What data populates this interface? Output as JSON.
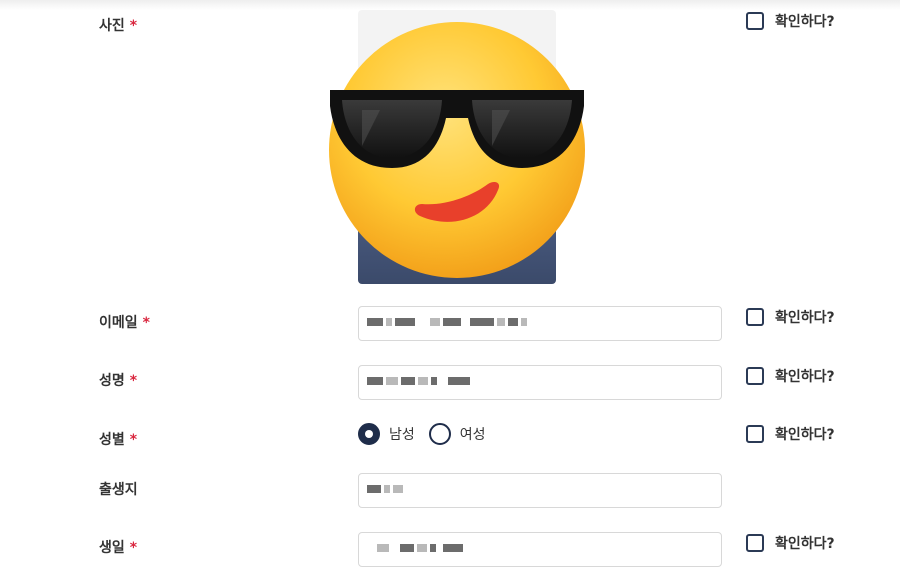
{
  "form": {
    "photo": {
      "label": "사진",
      "required_mark": "*",
      "confirm_label": "확인하다?"
    },
    "email": {
      "label": "이메일",
      "required_mark": "*",
      "confirm_label": "확인하다?",
      "value": ""
    },
    "name": {
      "label": "성명",
      "required_mark": "*",
      "confirm_label": "확인하다?",
      "value": ""
    },
    "gender": {
      "label": "성별",
      "required_mark": "*",
      "confirm_label": "확인하다?",
      "options": [
        {
          "label": "남성",
          "selected": true
        },
        {
          "label": "여성",
          "selected": false
        }
      ]
    },
    "birthplace": {
      "label": "출생지",
      "value": ""
    },
    "birthday": {
      "label": "생일",
      "required_mark": "*",
      "confirm_label": "확인하다?",
      "value": ""
    }
  },
  "colors": {
    "accent": "#1f2d4a",
    "required": "#d9263e"
  },
  "icons": {
    "photo_overlay": "sunglasses-emoji-icon"
  }
}
